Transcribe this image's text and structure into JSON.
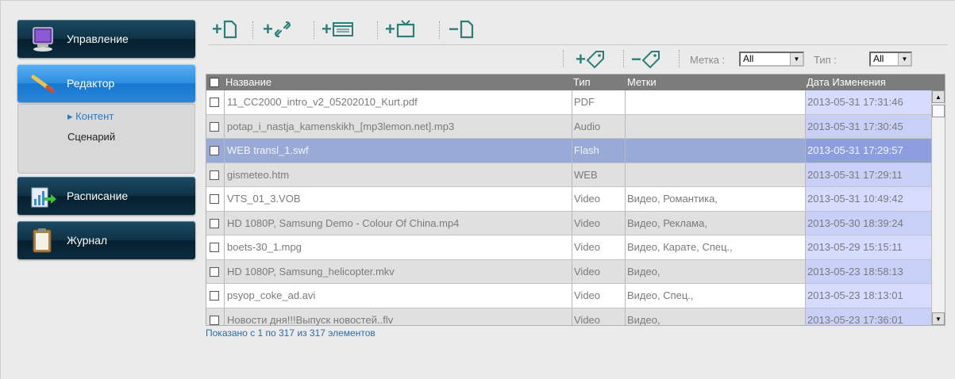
{
  "sidebar": {
    "items": [
      {
        "label": "Управление",
        "icon": "monitor-icon"
      },
      {
        "label": "Редактор",
        "icon": "pencil-icon"
      },
      {
        "label": "Расписание",
        "icon": "schedule-chart-icon"
      },
      {
        "label": "Журнал",
        "icon": "clipboard-icon"
      }
    ],
    "submenu": [
      {
        "label": "Контент",
        "active": true
      },
      {
        "label": "Сценарий",
        "active": false
      }
    ]
  },
  "toolbar": {
    "buttons": [
      {
        "name": "add-file-button",
        "icon": "file-icon"
      },
      {
        "name": "add-link-button",
        "icon": "link-icon"
      },
      {
        "name": "add-web-button",
        "icon": "web-page-icon"
      },
      {
        "name": "add-tv-button",
        "icon": "tv-icon"
      },
      {
        "name": "remove-file-button",
        "icon": "file-icon"
      }
    ]
  },
  "tagbar": {
    "add_tag": "+",
    "remove_tag": "−",
    "tag_filter_label": "Метка :",
    "tag_filter_value": "All",
    "type_filter_label": "Тип :",
    "type_filter_value": "All"
  },
  "table": {
    "columns": [
      "Название",
      "Тип",
      "Метки",
      "Дата Изменения"
    ],
    "rows": [
      {
        "name": "11_CC2000_intro_v2_05202010_Kurt.pdf",
        "type": "PDF",
        "tags": "",
        "date": "2013-05-31 17:31:46"
      },
      {
        "name": "potap_i_nastja_kamenskikh_[mp3lemon.net].mp3",
        "type": "Audio",
        "tags": "",
        "date": "2013-05-31 17:30:45"
      },
      {
        "name": "WEB transl_1.swf",
        "type": "Flash",
        "tags": "",
        "date": "2013-05-31 17:29:57"
      },
      {
        "name": "gismeteo.htm",
        "type": "WEB",
        "tags": "",
        "date": "2013-05-31 17:29:11"
      },
      {
        "name": "VTS_01_3.VOB",
        "type": "Video",
        "tags": "Видео, Романтика,",
        "date": "2013-05-31 10:49:42"
      },
      {
        "name": "HD 1080P, Samsung Demo - Colour Of China.mp4",
        "type": "Video",
        "tags": "Видео, Реклама,",
        "date": "2013-05-30 18:39:24"
      },
      {
        "name": "boets-30_1.mpg",
        "type": "Video",
        "tags": "Видео, Карате, Спец.,",
        "date": "2013-05-29 15:15:11"
      },
      {
        "name": "HD 1080P, Samsung_helicopter.mkv",
        "type": "Video",
        "tags": "Видео,",
        "date": "2013-05-23 18:58:13"
      },
      {
        "name": "psyop_coke_ad.avi",
        "type": "Video",
        "tags": "Видео, Спец.,",
        "date": "2013-05-23 18:13:01"
      },
      {
        "name": "Новости дня!!!Выпуск новостей..flv",
        "type": "Video",
        "tags": "Видео,",
        "date": "2013-05-23 17:36:01"
      }
    ]
  },
  "footer": {
    "status": "Показано с 1 по 317 из 317 элементов"
  },
  "colors": {
    "nav_dark": "#0e3347",
    "nav_active": "#2c8de0",
    "toolbar_icon": "#2a7f7a",
    "selected_row": "#9aaad6",
    "date_column": "#d6dcff"
  }
}
